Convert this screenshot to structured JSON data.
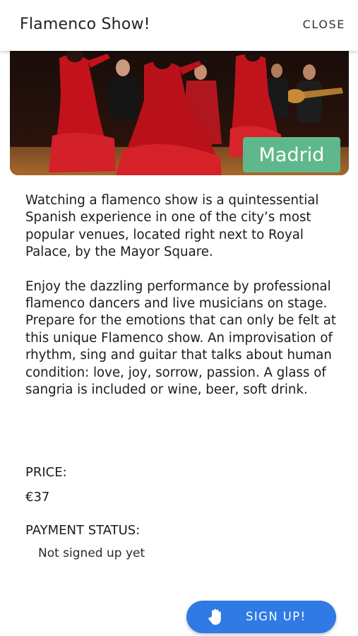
{
  "header": {
    "title": "Flamenco Show!",
    "close_label": "CLOSE"
  },
  "hero": {
    "city": "Madrid",
    "badge_color": "#5fb88c",
    "image_description_icon": "flamenco-dancers-photo"
  },
  "description": {
    "paragraphs": [
      "Watching a flamenco show is a quintessential Spanish experience in one of the city’s most popular venues, located right next to Royal Palace, by the Mayor Square.",
      "Enjoy the dazzling performance by professional flamenco dancers and live musicians on stage. Prepare for the emotions that can only be felt at this unique Flamenco show. An improvisation of rhythm, sing and guitar that talks about human condition: love, joy, sorrow, passion. A glass of sangria is included or wine, beer, soft drink."
    ]
  },
  "price": {
    "label": "PRICE:",
    "value": "€37"
  },
  "payment": {
    "label": "PAYMENT STATUS:",
    "value": "Not signed up yet"
  },
  "signup": {
    "label": "SIGN UP!",
    "icon": "hand-icon",
    "color": "#2f7ae5"
  }
}
